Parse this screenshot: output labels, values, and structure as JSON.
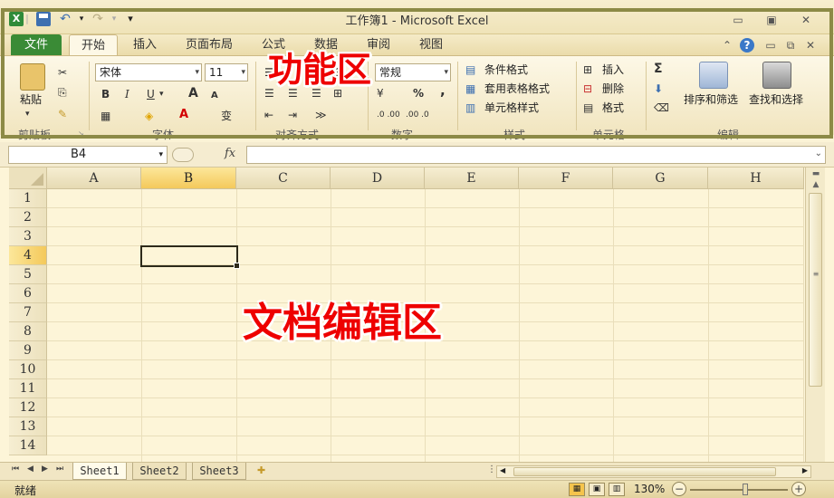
{
  "window": {
    "title": "工作簿1 - Microsoft Excel",
    "logo": "X",
    "quick_access": {
      "undo": "↶",
      "redo": "↷",
      "more": "▾"
    },
    "controls": {
      "minimize": "▭",
      "maximize": "▣",
      "close": "✕"
    }
  },
  "ribbon_tabs": [
    {
      "label": "文件"
    },
    {
      "label": "开始"
    },
    {
      "label": "插入"
    },
    {
      "label": "页面布局"
    },
    {
      "label": "公式"
    },
    {
      "label": "数据"
    },
    {
      "label": "审阅"
    },
    {
      "label": "视图"
    }
  ],
  "ribbon": {
    "clipboard": {
      "paste_label": "粘贴",
      "group_label": "剪贴板"
    },
    "font": {
      "font_name": "宋体",
      "font_size": "11",
      "bold": "B",
      "italic": "I",
      "underline": "U",
      "grow": "A",
      "shrink": "A",
      "font_color": "A",
      "phonetic": "变",
      "group_label": "字体"
    },
    "alignment": {
      "group_label": "对齐方式"
    },
    "number": {
      "format": "常规",
      "percent": "%",
      "comma": ",",
      "inc_decimal": ".0 .00",
      "dec_decimal": ".00 .0",
      "group_label": "数字"
    },
    "styles": {
      "conditional": "条件格式",
      "table": "套用表格格式",
      "cell": "单元格样式",
      "group_label": "样式"
    },
    "cells": {
      "insert": "插入",
      "delete": "删除",
      "format": "格式",
      "group_label": "单元格"
    },
    "editing": {
      "sum": "Σ",
      "sort": "排序和筛选",
      "find": "查找和选择",
      "group_label": "编辑"
    }
  },
  "annotations": {
    "ribbon_label": "功能区",
    "grid_label": "文档编辑区"
  },
  "formula_bar": {
    "cell_ref": "B4",
    "fx": "fx"
  },
  "columns": [
    "A",
    "B",
    "C",
    "D",
    "E",
    "F",
    "G",
    "H"
  ],
  "rows": [
    "1",
    "2",
    "3",
    "4",
    "5",
    "6",
    "7",
    "8",
    "9",
    "10",
    "11",
    "12",
    "13",
    "14"
  ],
  "selected_cell": {
    "column": "B",
    "row": "4"
  },
  "sheets": [
    {
      "label": "Sheet1"
    },
    {
      "label": "Sheet2"
    },
    {
      "label": "Sheet3"
    }
  ],
  "status_bar": {
    "status": "就绪",
    "zoom": "130%",
    "zoom_out": "−",
    "zoom_in": "+"
  },
  "colors": {
    "accent_green": "#3a8b36",
    "annotation_red": "#ee0000",
    "selection_highlight": "#f4c95b",
    "frame_olive": "#8c8a46"
  }
}
